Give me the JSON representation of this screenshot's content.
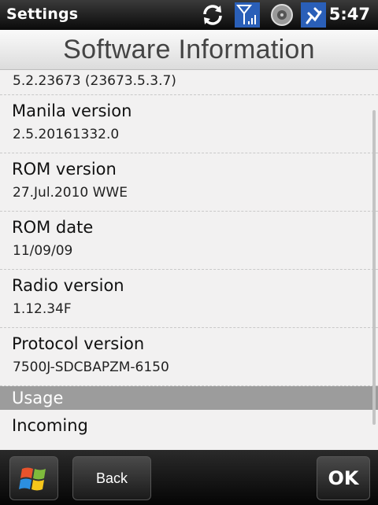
{
  "status": {
    "title": "Settings",
    "time": "5:47"
  },
  "header": {
    "title": "Software Information"
  },
  "list": {
    "first_value": "5.2.23673 (23673.5.3.7)",
    "items": [
      {
        "label": "Manila version",
        "value": "2.5.20161332.0"
      },
      {
        "label": "ROM version",
        "value": "27.Jul.2010 WWE"
      },
      {
        "label": "ROM date",
        "value": "11/09/09"
      },
      {
        "label": "Radio version",
        "value": "1.12.34F"
      },
      {
        "label": "Protocol version",
        "value": "7500J-SDCBAPZM-6150"
      }
    ],
    "section": "Usage",
    "partial_item": {
      "label": "Incoming"
    }
  },
  "softbar": {
    "back": "Back",
    "ok": "OK"
  },
  "icons": [
    "sync-icon",
    "signal-icon",
    "speaker-icon",
    "battery-charging-icon",
    "windows-start-icon"
  ]
}
